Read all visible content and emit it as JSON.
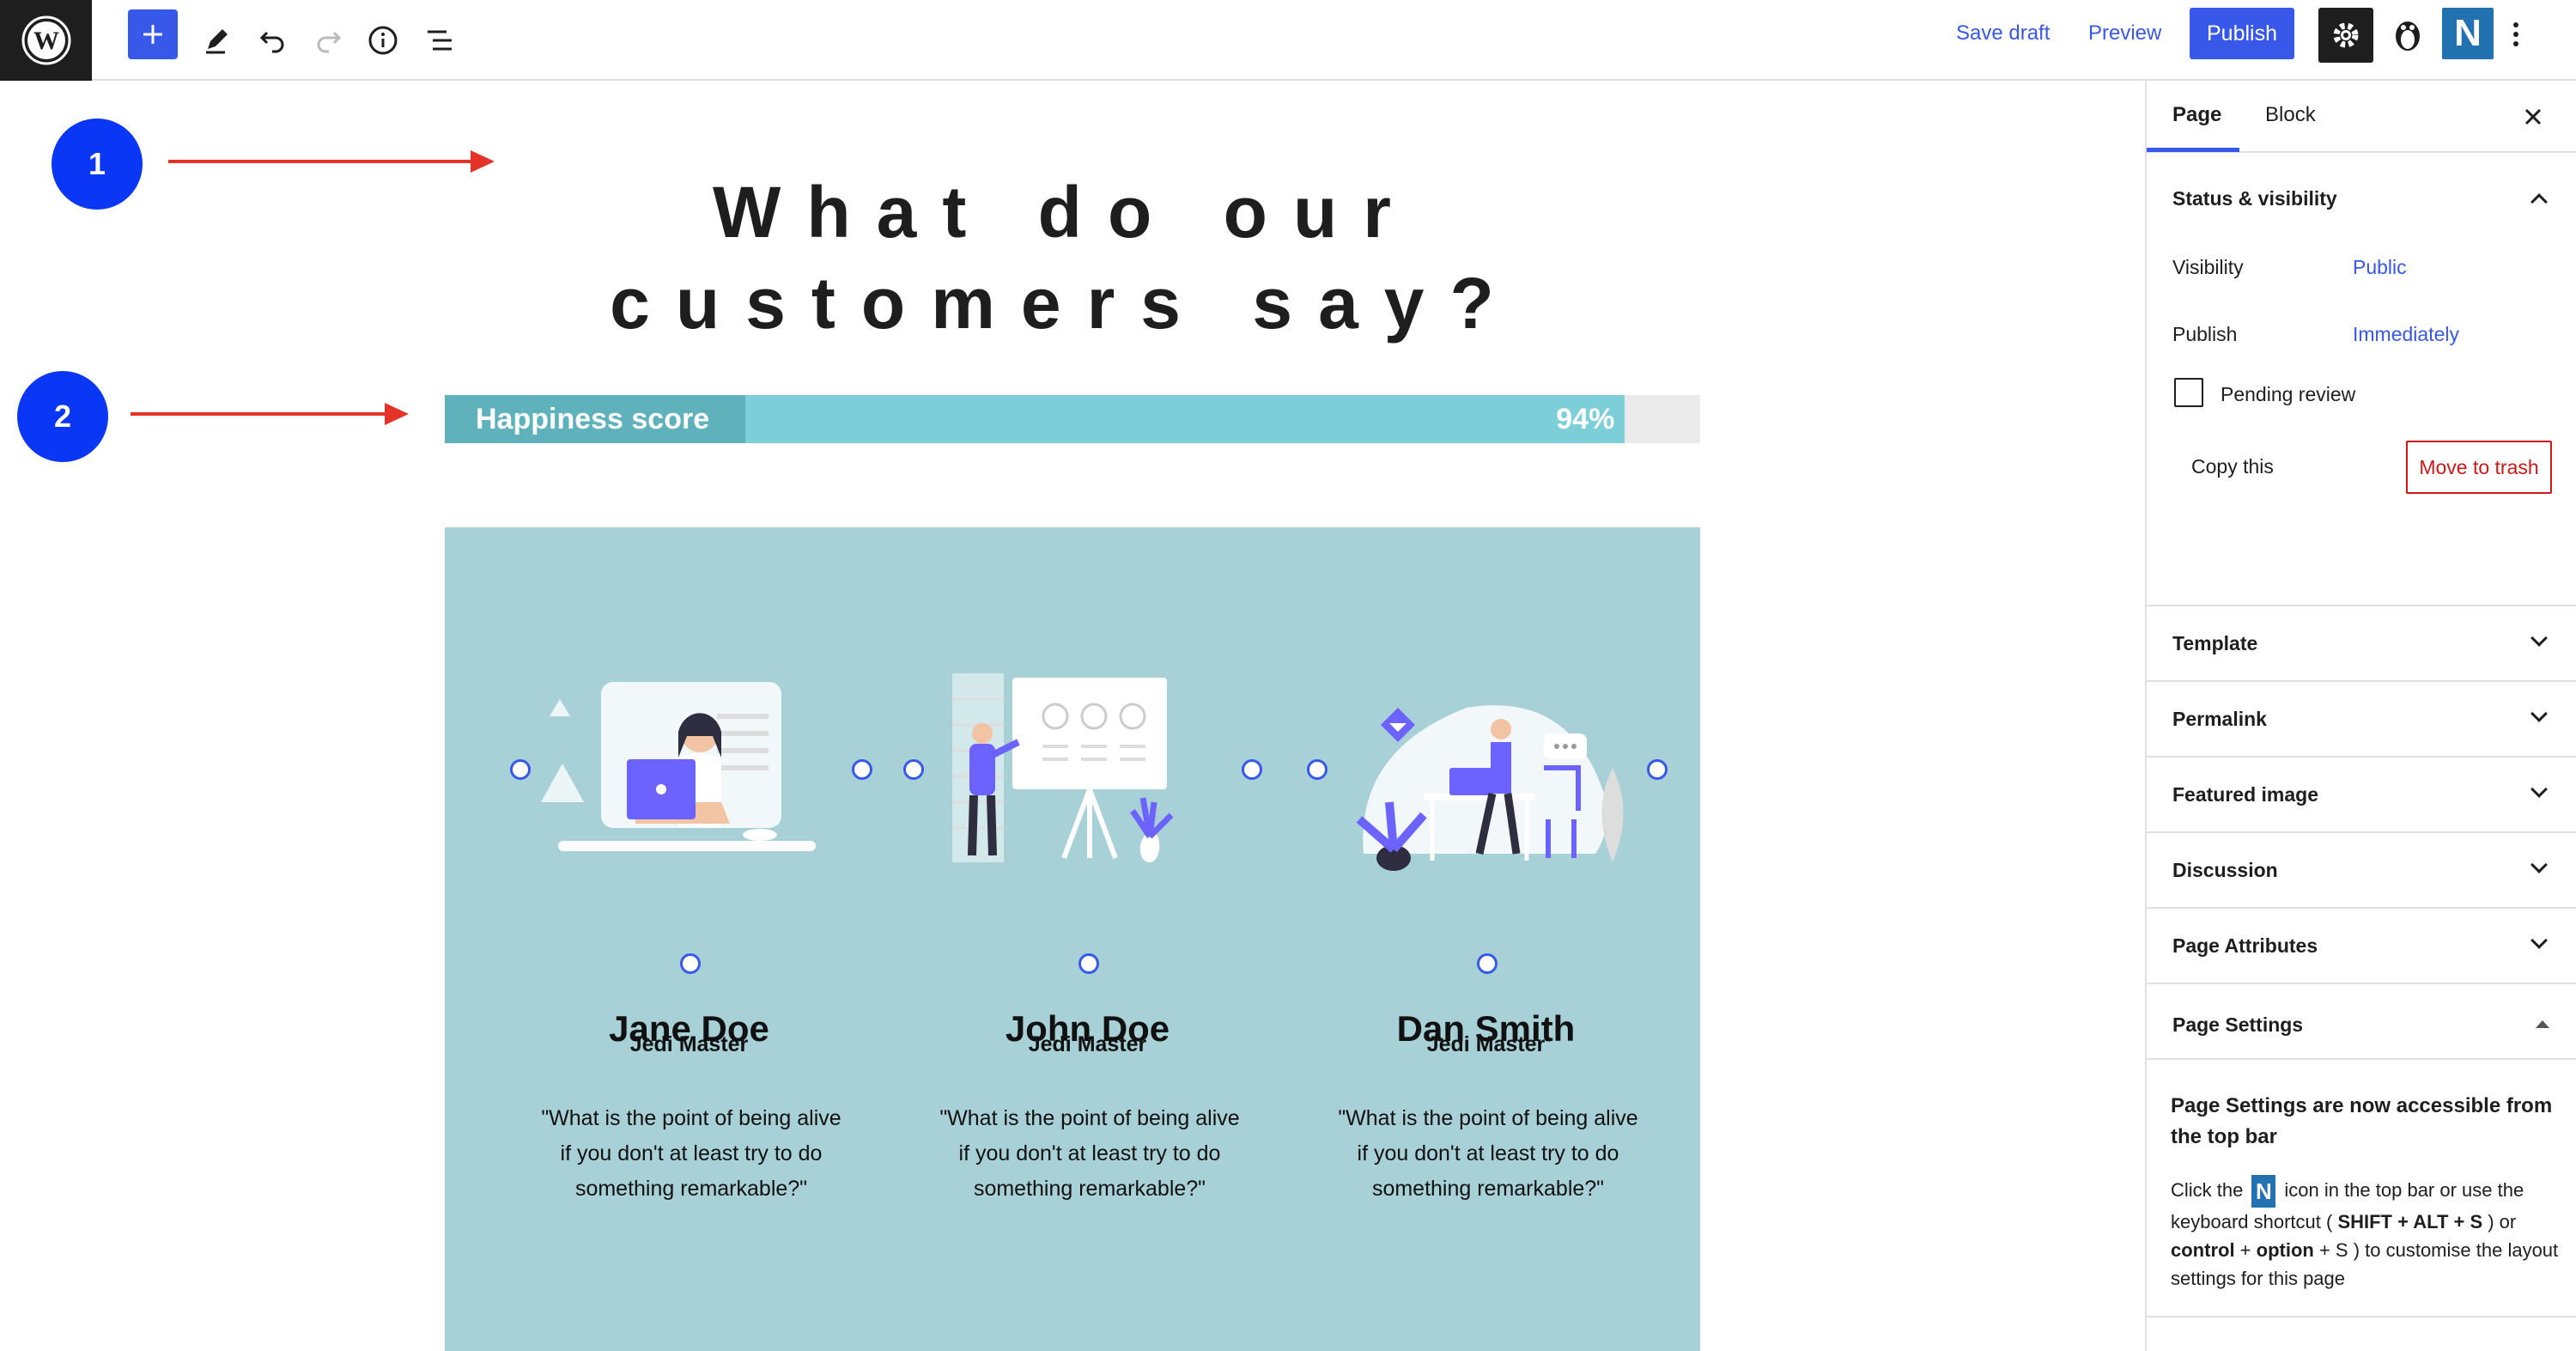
{
  "toolbar": {
    "save_draft": "Save draft",
    "preview": "Preview",
    "publish": "Publish",
    "n_logo": "N",
    "icons": [
      "wordpress-logo-icon",
      "plus-icon",
      "pencil-icon",
      "undo-icon",
      "redo-icon",
      "info-icon",
      "list-view-icon",
      "gear-icon",
      "penguin-icon",
      "n-logo-icon",
      "more-vertical-icon"
    ]
  },
  "canvas": {
    "heading": "What do our customers say?",
    "callout1": "1",
    "callout2": "2",
    "progress": {
      "label": "Happiness score",
      "value_text": "94%",
      "value": 94
    },
    "cards": [
      {
        "name": "Jane Doe",
        "role": "Jedi Master",
        "quote": "\"What is the point of being alive if you don't at least try to do something remarkable?\""
      },
      {
        "name": "John Doe",
        "role": "Jedi Master",
        "quote": "\"What is the point of being alive if you don't at least try to do something remarkable?\""
      },
      {
        "name": "Dan Smith",
        "role": "Jedi Master",
        "quote": "\"What is the point of being alive if you don't at least try to do something remarkable?\""
      }
    ]
  },
  "sidebar": {
    "tab_page": "Page",
    "tab_block": "Block",
    "status_title": "Status & visibility",
    "visibility_label": "Visibility",
    "visibility_value": "Public",
    "publish_label": "Publish",
    "publish_value": "Immediately",
    "pending_review": "Pending review",
    "copy_this": "Copy this",
    "move_to_trash": "Move to trash",
    "panels": [
      "Template",
      "Permalink",
      "Featured image",
      "Discussion",
      "Page Attributes"
    ],
    "page_settings_title": "Page Settings",
    "notice_title": "Page Settings are now accessible from the top bar",
    "notice_pre": "Click the",
    "notice_n": "N",
    "notice_mid": "icon in the top bar or use the keyboard shortcut (",
    "shortcut1": "SHIFT + ALT + S",
    "notice_or": ")\nor",
    "shortcut2_a": "control",
    "shortcut2_b": "option",
    "notice_end": "to customise the layout settings for this page"
  },
  "colors": {
    "accent": "#3858e9",
    "bar_label": "#5fb2bc",
    "bar_fill": "#7ccfd8",
    "section_bg": "#a7d0d7",
    "trash": "#cc1818",
    "callout": "#0a36f5",
    "arrow": "#e5332a"
  }
}
